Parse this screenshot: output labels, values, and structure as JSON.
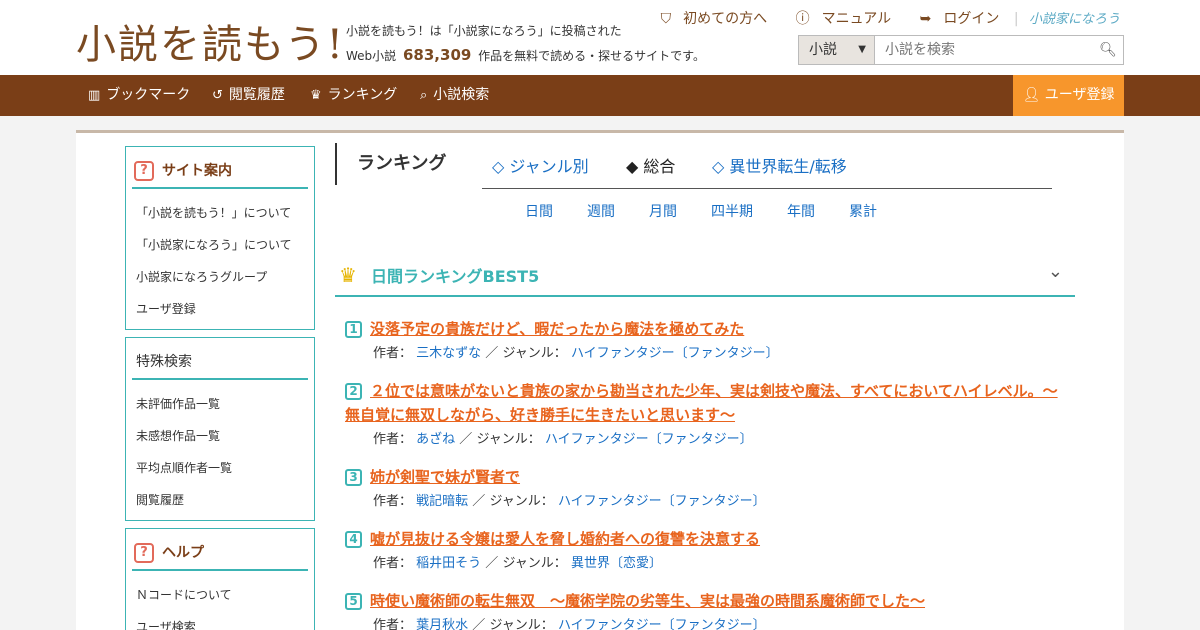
{
  "header": {
    "logo": "小説を読もう!",
    "tagline_line1": "小説を読もう！は「小説家になろう」に投稿された",
    "tagline_prefix": "Web小説",
    "tagline_count": "683,309",
    "tagline_suffix": "作品を無料で読める・探せるサイトです。",
    "links": {
      "first": "初めての方へ",
      "manual": "マニュアル",
      "login": "ログイン",
      "narou": "小説家になろう"
    },
    "search": {
      "select_value": "小説",
      "placeholder": "小説を検索"
    }
  },
  "nav": {
    "bookmark": "ブックマーク",
    "history": "閲覧履歴",
    "ranking": "ランキング",
    "search": "小説検索",
    "register": "ユーザ登録"
  },
  "sidebar": {
    "guide": {
      "title": "サイト案内",
      "items": [
        "「小説を読もう！」について",
        "「小説家になろう」について",
        "小説家になろうグループ",
        "ユーザ登録"
      ]
    },
    "special": {
      "title": "特殊検索",
      "items": [
        "未評価作品一覧",
        "未感想作品一覧",
        "平均点順作者一覧",
        "閲覧履歴"
      ]
    },
    "help": {
      "title": "ヘルプ",
      "items": [
        "Ｎコードについて",
        "ユーザ検索"
      ]
    }
  },
  "ranking": {
    "title": "ランキング",
    "tabs": [
      "◇ ジャンル別",
      "◆ 総合",
      "◇ 異世界転生/転移"
    ],
    "periods": [
      "日間",
      "週間",
      "月間",
      "四半期",
      "年間",
      "累計"
    ],
    "best_title": "日間ランキングBEST5",
    "author_label": "作者：",
    "genre_label": "ジャンル：",
    "entries": [
      {
        "rank": "1",
        "title": "没落予定の貴族だけど、暇だったから魔法を極めてみた",
        "author": "三木なずな",
        "genre": "ハイファンタジー〔ファンタジー〕"
      },
      {
        "rank": "2",
        "title": "２位では意味がないと貴族の家から勘当された少年、実は剣技や魔法、すべてにおいてハイレベル。～無自覚に無双しながら、好き勝手に生きたいと思います～",
        "author": "あざね",
        "genre": "ハイファンタジー〔ファンタジー〕"
      },
      {
        "rank": "3",
        "title": "姉が剣聖で妹が賢者で",
        "author": "戦記暗転",
        "genre": "ハイファンタジー〔ファンタジー〕"
      },
      {
        "rank": "4",
        "title": "嘘が見抜ける令嬢は愛人を脅し婚約者への復讐を決意する",
        "author": "稲井田そう",
        "genre": "異世界〔恋愛〕"
      },
      {
        "rank": "5",
        "title": "時使い魔術師の転生無双　～魔術学院の劣等生、実は最強の時間系魔術師でした～",
        "author": "葉月秋水",
        "genre": "ハイファンタジー〔ファンタジー〕"
      }
    ]
  }
}
